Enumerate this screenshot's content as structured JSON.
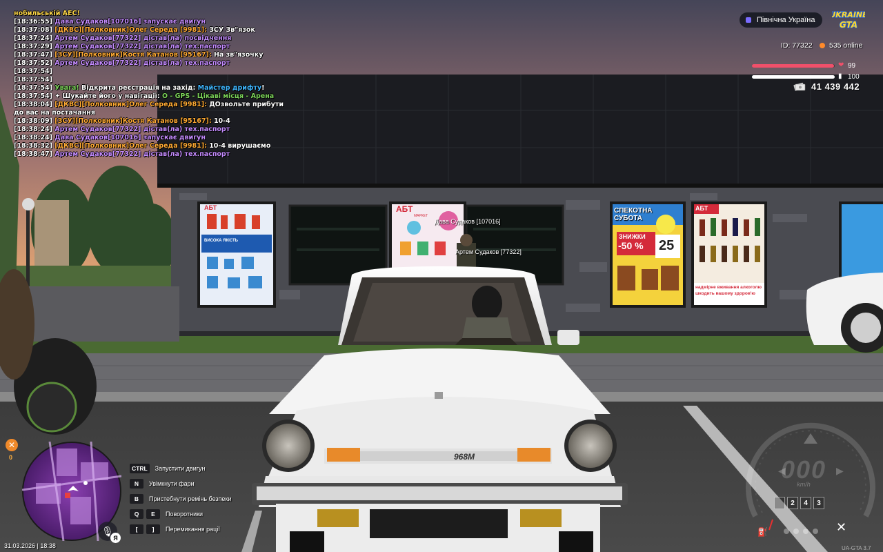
{
  "chat": {
    "lines": [
      [
        {
          "t": "нобильській АЕС!",
          "c": "c-yellow"
        }
      ],
      [
        {
          "t": "[18:36:55] ",
          "c": "c-white"
        },
        {
          "t": "Дава Судаков[107016] запускає двигун",
          "c": "c-purple"
        }
      ],
      [
        {
          "t": "[18:37:08] ",
          "c": "c-white"
        },
        {
          "t": "[ДКВС][Полковник]Олег Середа [9981]: ",
          "c": "c-orange"
        },
        {
          "t": "ЗСУ Зв\"язок",
          "c": "c-white"
        }
      ],
      [
        {
          "t": "[18:37:24] ",
          "c": "c-white"
        },
        {
          "t": "Артем Судаков[77322] дістав(ла) посвідчення",
          "c": "c-purple"
        }
      ],
      [
        {
          "t": "[18:37:29] ",
          "c": "c-white"
        },
        {
          "t": "Артем Судаков[77322] дістав(ла) тех.паспорт",
          "c": "c-purple"
        }
      ],
      [
        {
          "t": "[18:37:47] ",
          "c": "c-white"
        },
        {
          "t": "[ЗСУ][Полковник]Костя Катанов [95167]: ",
          "c": "c-orange"
        },
        {
          "t": "На зв\"язочку",
          "c": "c-white"
        }
      ],
      [
        {
          "t": "[18:37:52] ",
          "c": "c-white"
        },
        {
          "t": "Артем Судаков[77322] дістав(ла) тех.паспорт",
          "c": "c-purple"
        }
      ],
      [
        {
          "t": "[18:37:54]",
          "c": "c-white"
        }
      ],
      [
        {
          "t": "[18:37:54]",
          "c": "c-white"
        }
      ],
      [
        {
          "t": "[18:37:54] ",
          "c": "c-white"
        },
        {
          "t": "Увага! ",
          "c": "c-green"
        },
        {
          "t": "Відкрита реєстрація на захід: ",
          "c": "c-white"
        },
        {
          "t": "Майстер дрифту",
          "c": "c-cyan"
        },
        {
          "t": "!",
          "c": "c-white"
        }
      ],
      [
        {
          "t": "[18:37:54] ",
          "c": "c-white"
        },
        {
          "t": "✦ Шукайте його у навігації: ",
          "c": "c-white"
        },
        {
          "t": "O - GPS - Цікаві місця - Арена",
          "c": "c-green"
        }
      ],
      [
        {
          "t": "[18:38:04] ",
          "c": "c-white"
        },
        {
          "t": "[ДКВС][Полковник]Олег Середа [9981]: ",
          "c": "c-orange"
        },
        {
          "t": "ДОзвольте прибути до вас на постачання",
          "c": "c-white"
        }
      ],
      [
        {
          "t": "[18:38:09] ",
          "c": "c-white"
        },
        {
          "t": "[ЗСУ][Полковник]Костя Катанов [95167]: ",
          "c": "c-orange"
        },
        {
          "t": "10-4",
          "c": "c-white"
        }
      ],
      [
        {
          "t": "[18:38:24] ",
          "c": "c-white"
        },
        {
          "t": "Артем Судаков[77322] дістав(ла) тех.паспорт",
          "c": "c-purple"
        }
      ],
      [
        {
          "t": "[18:38:24] ",
          "c": "c-white"
        },
        {
          "t": "Дава Судаков[107016] запускає двигун",
          "c": "c-purple"
        }
      ],
      [
        {
          "t": "[18:38:32] ",
          "c": "c-white"
        },
        {
          "t": "[ДКВС][Полковник]Олег Середа [9981]: ",
          "c": "c-orange"
        },
        {
          "t": "10-4 вирушаємо",
          "c": "c-white"
        }
      ],
      [
        {
          "t": "[18:38:47] ",
          "c": "c-white"
        },
        {
          "t": "Артем Судаков[77322] дістав(ла) тех.паспорт",
          "c": "c-purple"
        }
      ]
    ]
  },
  "hud": {
    "region": "Північна Україна",
    "logo_line1": "UKRAINE",
    "logo_line2": "GTA",
    "id_text": "ID: 77322",
    "online_text": "535 online",
    "health": 99,
    "armor": 100,
    "money": "41 439 442",
    "wanted_value": "0",
    "datetime": "31.03.2026 | 18:38",
    "version": "UA-GTA 3.7",
    "kb_layout": "Я"
  },
  "hints": [
    {
      "keys": [
        "CTRL"
      ],
      "label": "Запустити двигун"
    },
    {
      "keys": [
        "N"
      ],
      "label": "Увімкнути фари"
    },
    {
      "keys": [
        "B"
      ],
      "label": "Пристебнути ремінь безпеки"
    },
    {
      "keys": [
        "Q",
        "E"
      ],
      "label": "Поворотники"
    },
    {
      "keys": [
        "[",
        "]"
      ],
      "label": "Перемикання рації"
    }
  ],
  "speedometer": {
    "speed": "000",
    "unit": "km/h",
    "gears": [
      "",
      "2",
      "4",
      "3"
    ]
  },
  "world": {
    "player_tag_1": "Дава Судаков [107016]",
    "player_tag_2": "Артем Судаков [77322]",
    "car_badge": "968М",
    "poster_1_brand": "АБТ",
    "poster_1_text": "ВИСОКА ЯКІСТЬ",
    "poster_2_brand": "АБТ",
    "poster_2_sub": "МАРКЕТ",
    "poster_3_title": "СПЕКОТНА СУБОТА",
    "poster_3_sale": "ЗНИЖКИ",
    "poster_3_pct": "-50 %",
    "poster_3_day": "25",
    "poster_4_brand": "АБТ",
    "poster_4_foot": "надмірне вживання алкоголю шкодить вашому здоров'ю"
  },
  "colors": {
    "sky_top": "#4a4a5e",
    "sky_bottom": "#e0a070",
    "building": "#1c1d22",
    "wall": "#4e4f55",
    "car": "#f2f2f2",
    "health": "#f0506a",
    "accent_orange": "#ff8a2a"
  }
}
